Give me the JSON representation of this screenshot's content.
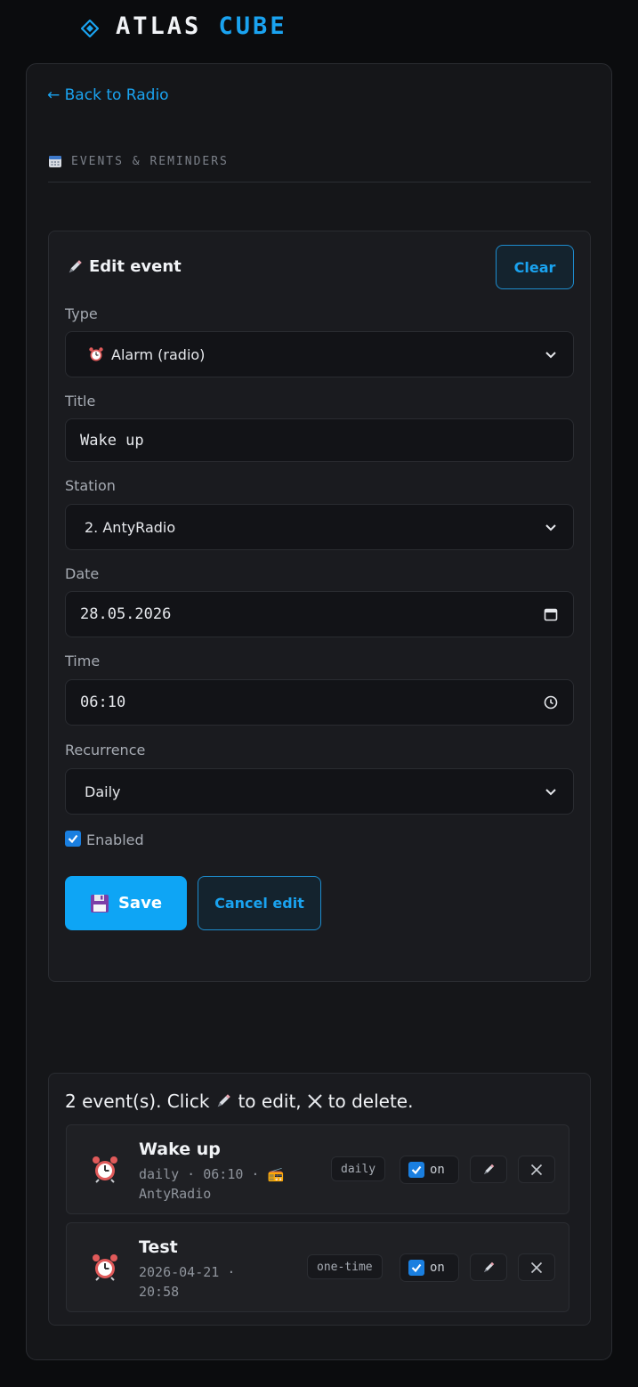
{
  "brand": {
    "word1": "ATLAS",
    "word2": "CUBE",
    "accent_color": "#1aa3f0"
  },
  "nav": {
    "back_label": "← Back to Radio"
  },
  "section": {
    "label": "EVENTS & REMINDERS",
    "icon": "calendar-icon"
  },
  "editor": {
    "title": "Edit event",
    "title_icon": "pencil-icon",
    "clear_label": "Clear",
    "type_label": "Type",
    "type_value": "Alarm (radio)",
    "type_icon": "alarm-clock-icon",
    "title_label": "Title",
    "title_value": "Wake up",
    "station_label": "Station",
    "station_value": "2. AntyRadio",
    "date_label": "Date",
    "date_value": "28.05.2026",
    "time_label": "Time",
    "time_value": "06:10",
    "recurrence_label": "Recurrence",
    "recurrence_value": "Daily",
    "enabled_label": "Enabled",
    "enabled": true,
    "save_label": "Save",
    "save_icon": "floppy-disk-icon",
    "cancel_label": "Cancel edit"
  },
  "events_list": {
    "summary_prefix": "2 event(s). Click",
    "summary_mid": "to edit,",
    "summary_suffix": "to delete.",
    "items": [
      {
        "title": "Wake up",
        "meta_line1": "daily · 06:10 · 📻",
        "meta_line2": "AntyRadio",
        "badge": "daily",
        "toggle_label": "on",
        "enabled": true,
        "icon": "alarm-clock-icon"
      },
      {
        "title": "Test",
        "meta_line1": "2026-04-21 ·",
        "meta_line2": "20:58",
        "badge": "one-time",
        "toggle_label": "on",
        "enabled": true,
        "icon": "alarm-clock-icon"
      }
    ]
  }
}
